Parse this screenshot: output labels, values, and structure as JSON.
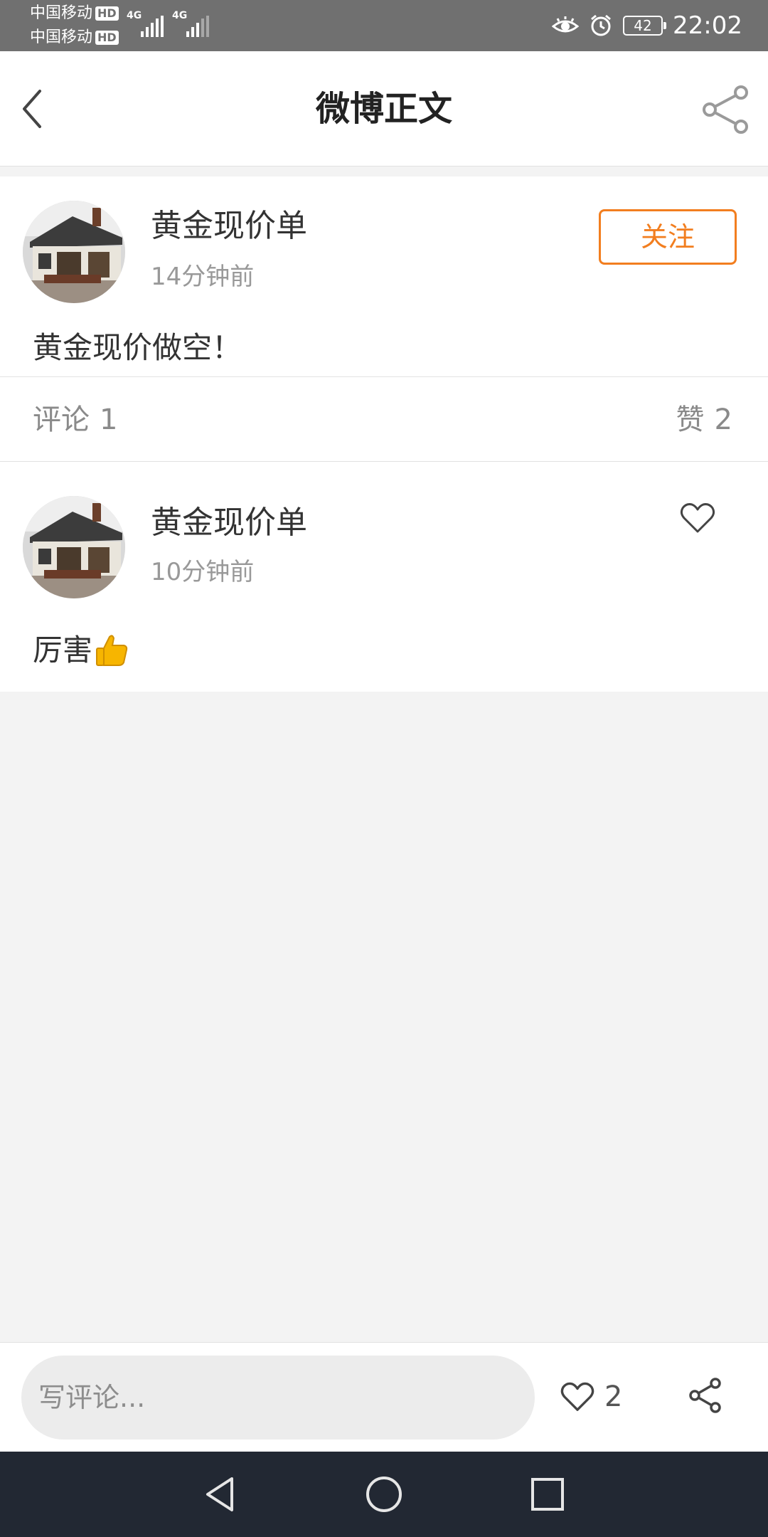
{
  "status_bar": {
    "carrier1": "中国移动",
    "carrier2": "中国移动",
    "hd_badge": "HD",
    "network1": "4G",
    "network2": "4G",
    "battery": "42",
    "time": "22:02",
    "icons": [
      "eye-comfort-icon",
      "alarm-icon",
      "battery-icon"
    ]
  },
  "header": {
    "title": "微博正文",
    "back_icon": "chevron-left-icon",
    "share_icon": "share-icon"
  },
  "post": {
    "author": "黄金现价单",
    "time": "14分钟前",
    "follow_label": "关注",
    "text": "黄金现价做空！"
  },
  "stats": {
    "comments_label": "评论",
    "comments_count": "1",
    "likes_label": "赞",
    "likes_count": "2"
  },
  "comment": {
    "author": "黄金现价单",
    "time": "10分钟前",
    "text": "厉害",
    "emoji_icon": "thumbs-up-emoji"
  },
  "action_bar": {
    "placeholder": "写评论...",
    "like_count": "2"
  },
  "colors": {
    "accent": "#f27e1f",
    "status_bar": "#707070",
    "nav_bar": "#222833",
    "background": "#f3f3f3"
  }
}
